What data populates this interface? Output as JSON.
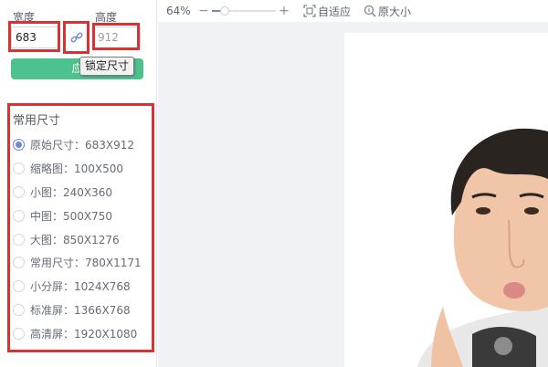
{
  "size_form": {
    "width_label": "宽度",
    "width_value": "683",
    "height_label": "高度",
    "height_placeholder": "912",
    "apply_label": "应",
    "lock_tooltip": "锁定尺寸"
  },
  "presets": {
    "title": "常用尺寸",
    "items": [
      {
        "label": "原始尺寸：683X912",
        "checked": true
      },
      {
        "label": "缩略图：100X500"
      },
      {
        "label": "小图：240X360"
      },
      {
        "label": "中图：500X750"
      },
      {
        "label": "大图：850X1276"
      },
      {
        "label": "常用尺寸：780X1171"
      },
      {
        "label": "小分屏：1024X768"
      },
      {
        "label": "标准屏：1366X768"
      },
      {
        "label": "高清屏：1920X1080"
      }
    ]
  },
  "toolbar": {
    "zoom_value": "64%",
    "zoom_fraction": 0.2,
    "zoom_out_symbol": "−",
    "zoom_in_symbol": "+",
    "fit_label": "自适应",
    "original_label": "原大小"
  },
  "colors": {
    "accent": "#4cc28f",
    "radio_selected": "#6f86d6",
    "highlight_box": "#d93232"
  },
  "icons": {
    "lock": "link-icon",
    "fit": "fit-screen-icon",
    "original": "zoom-magnifier-icon"
  }
}
